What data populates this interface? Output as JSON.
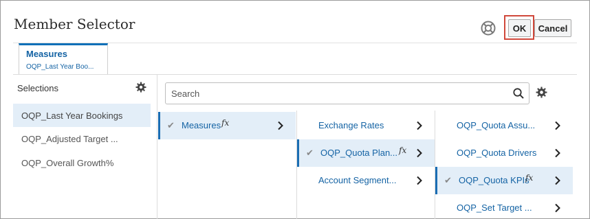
{
  "dialog": {
    "title": "Member Selector",
    "ok_label": "OK",
    "cancel_label": "Cancel"
  },
  "tab": {
    "title": "Measures",
    "subtitle": "OQP_Last Year Boo..."
  },
  "selections": {
    "header": "Selections",
    "items": [
      {
        "label": "OQP_Last Year Bookings",
        "active": true
      },
      {
        "label": "OQP_Adjusted Target ...",
        "active": false
      },
      {
        "label": "OQP_Overall Growth%",
        "active": false
      }
    ]
  },
  "search": {
    "placeholder": "Search"
  },
  "columns": [
    {
      "items": [
        {
          "label": "Measures",
          "checked": true,
          "fx": "fx",
          "active": true
        }
      ]
    },
    {
      "items": [
        {
          "label": "Exchange Rates",
          "checked": false,
          "fx": "",
          "active": false
        },
        {
          "label": "OQP_Quota Plan...",
          "checked": true,
          "fx": "fx",
          "active": true
        },
        {
          "label": "Account Segment...",
          "checked": false,
          "fx": "",
          "active": false
        }
      ]
    },
    {
      "items": [
        {
          "label": "OQP_Quota Assu...",
          "checked": false,
          "fx": "",
          "active": false
        },
        {
          "label": "OQP_Quota Drivers",
          "checked": false,
          "fx": "",
          "active": false
        },
        {
          "label": "OQP_Quota KPIs",
          "checked": true,
          "fx": "fx",
          "active": true
        },
        {
          "label": "OQP_Set Target ...",
          "checked": false,
          "fx": "",
          "active": false
        }
      ]
    }
  ],
  "icons": {
    "help": "help-lifebuoy-icon",
    "settings": "gear-icon",
    "search": "search-icon",
    "check": "check-icon",
    "chevron": "chevron-right-icon"
  },
  "colors": {
    "accent": "#1463a4",
    "tab_border": "#0b6fb8",
    "selected_bg": "#e3eef8",
    "ok_highlight": "#d0473a"
  }
}
